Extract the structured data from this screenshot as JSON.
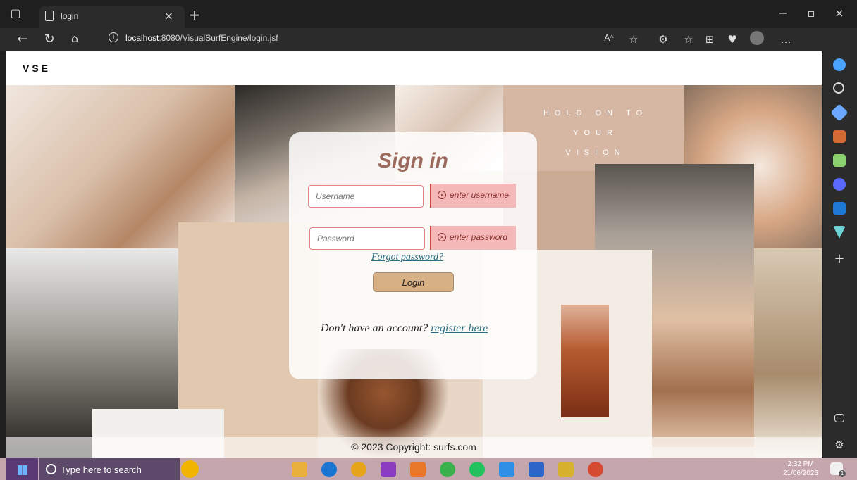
{
  "browser": {
    "tab_title": "login",
    "url_host": "localhost",
    "url_path": ":8080/VisualSurfEngine/login.jsf"
  },
  "site": {
    "brand": "VSE",
    "collage_text": "HOLD ON TO YOUR VISION"
  },
  "login": {
    "title": "Sign in",
    "username_placeholder": "Username",
    "username_error": "enter username",
    "password_placeholder": "Password",
    "password_error": "enter password",
    "forgot_password": "Forgot password?",
    "login_button": "Login",
    "signup_prompt": "Don't have an account?",
    "signup_link": "register here"
  },
  "footer": {
    "copyright": "© 2023 Copyright: surfs.com"
  },
  "taskbar": {
    "search_placeholder": "Type here to search",
    "time": "2:32 PM",
    "date": "21/06/2023",
    "notification_count": "1"
  },
  "colors": {
    "title": "#9b6a5c",
    "link": "#2b6e82",
    "error_bg": "#f4b8b8",
    "button": "#d8b086"
  }
}
